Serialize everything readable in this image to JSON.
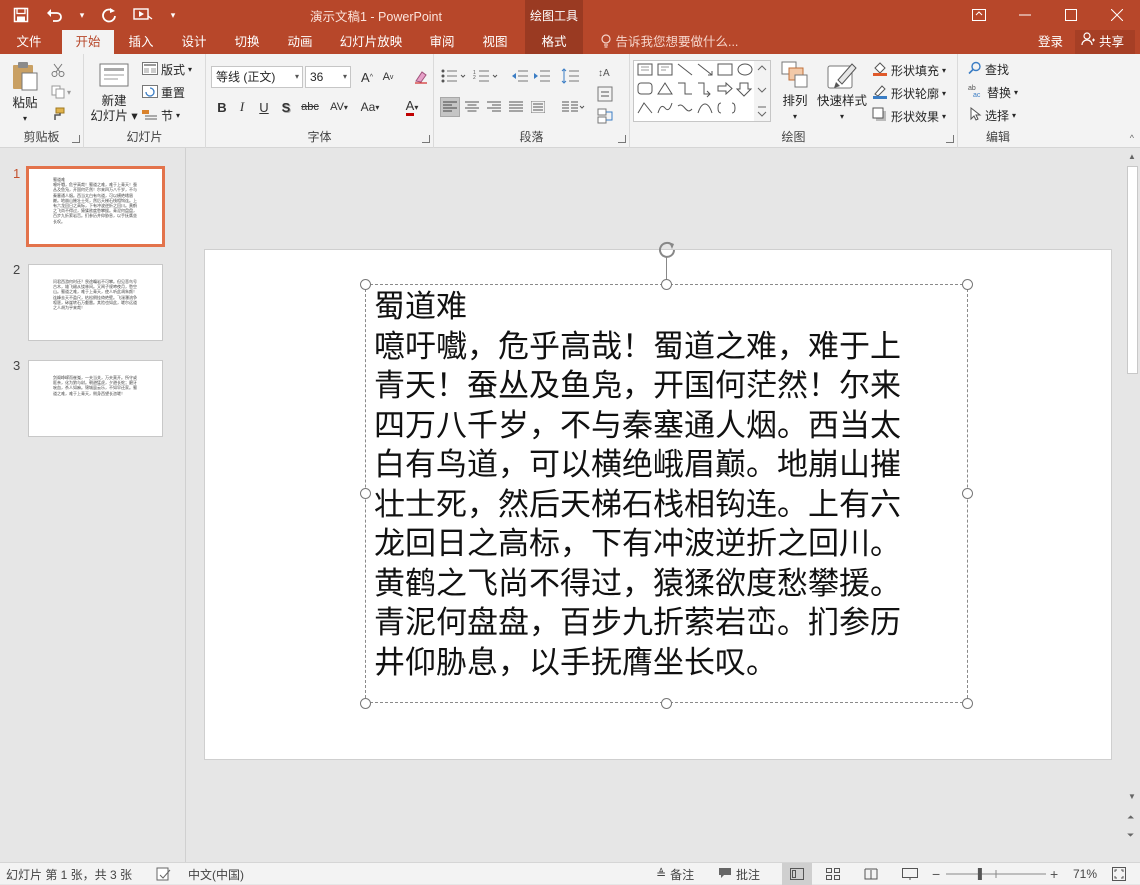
{
  "titlebar": {
    "title": "演示文稿1 - PowerPoint",
    "context_group": "绘图工具",
    "qat": {
      "save_icon": "save-icon",
      "undo_icon": "undo-icon",
      "redo_icon": "redo-icon",
      "present_icon": "present-from-start-icon"
    },
    "window_buttons": [
      "restore-ribbon-icon",
      "minimize-icon",
      "maximize-icon",
      "close-icon"
    ]
  },
  "tabs": [
    "文件",
    "开始",
    "插入",
    "设计",
    "切换",
    "动画",
    "幻灯片放映",
    "审阅",
    "视图",
    "格式"
  ],
  "active_tab": "开始",
  "tell_me": "告诉我您想要做什么...",
  "login": "登录",
  "share": "共享",
  "ribbon": {
    "clipboard": {
      "label": "剪贴板",
      "paste": "粘贴"
    },
    "slides": {
      "label": "幻灯片",
      "new_slide_1": "新建",
      "new_slide_2": "幻灯片",
      "layout": "版式",
      "reset": "重置",
      "section": "节"
    },
    "font": {
      "label": "字体",
      "font_name": "等线 (正文)",
      "font_size": "36",
      "bold": "B",
      "italic": "I",
      "underline": "U",
      "shadow": "S",
      "strike": "abc",
      "spacing": "AV",
      "case": "Aa",
      "color": "A",
      "grow": "A",
      "shrink": "A"
    },
    "paragraph": {
      "label": "段落"
    },
    "drawing": {
      "label": "绘图",
      "arrange": "排列",
      "quick_styles": "快速样式",
      "fill": "形状填充",
      "outline": "形状轮廓",
      "effects": "形状效果"
    },
    "editing": {
      "label": "编辑",
      "find": "查找",
      "replace": "替换",
      "select": "选择"
    }
  },
  "thumbnails": [
    {
      "number": "1",
      "text": "蜀道难\n噫吁嚱，危乎高哉！蜀道之难，难于上青天！蚕丛及鱼凫，开国何茫然！尔来四万八千岁，不与秦塞通人烟。西当太白有鸟道，可以横绝峨眉巅。地崩山摧壮士死，然后天梯石栈相钩连。上有六龙回日之高标，下有冲波逆折之回川。黄鹤之飞尚不得过，猿猱欲度愁攀援。青泥何盘盘，百步九折萦岩峦。扪参历井仰胁息，以手抚膺坐长叹。"
    },
    {
      "number": "2",
      "text": "问君西游何时还？畏途巉岩不可攀。但见悲鸟号古木，雄飞雌从绕林间。又闻子规啼夜月，愁空山。蜀道之难，难于上青天，使人听此凋朱颜！连峰去天不盈尺，枯松倒挂倚绝壁。飞湍瀑流争喧豗，砯崖转石万壑雷。其险也如此，嗟尔远道之人胡为乎来哉！"
    },
    {
      "number": "3",
      "text": "剑阁峥嵘而崔嵬，一夫当关，万夫莫开。所守或匪亲，化为狼与豺。朝避猛虎，夕避长蛇；磨牙吮血，杀人如麻。锦城虽云乐，不如早还家。蜀道之难，难于上青天，侧身西望长咨嗟！"
    }
  ],
  "slide": {
    "title": "蜀道难",
    "lines": [
      "噫吁嚱，危乎高哉！蜀道之难，难于上",
      "青天！蚕丛及鱼凫，开国何茫然！尔来",
      "四万八千岁，不与秦塞通人烟。西当太",
      "白有鸟道，可以横绝峨眉巅。地崩山摧",
      "壮士死，然后天梯石栈相钩连。上有六",
      "龙回日之高标，下有冲波逆折之回川。",
      "黄鹤之飞尚不得过，猿猱欲度愁攀援。",
      "青泥何盘盘，百步九折萦岩峦。扪参历",
      "井仰胁息，以手抚膺坐长叹。"
    ]
  },
  "status": {
    "slide_info": "幻灯片 第 1 张，共 3 张",
    "language": "中文(中国)",
    "notes": "备注",
    "comments": "批注",
    "zoom": "71%",
    "zoom_level": 0.71
  },
  "colors": {
    "accent": "#b7472a",
    "context_tab": "#9a3a22",
    "selected_thumb_border": "#e3734b"
  }
}
